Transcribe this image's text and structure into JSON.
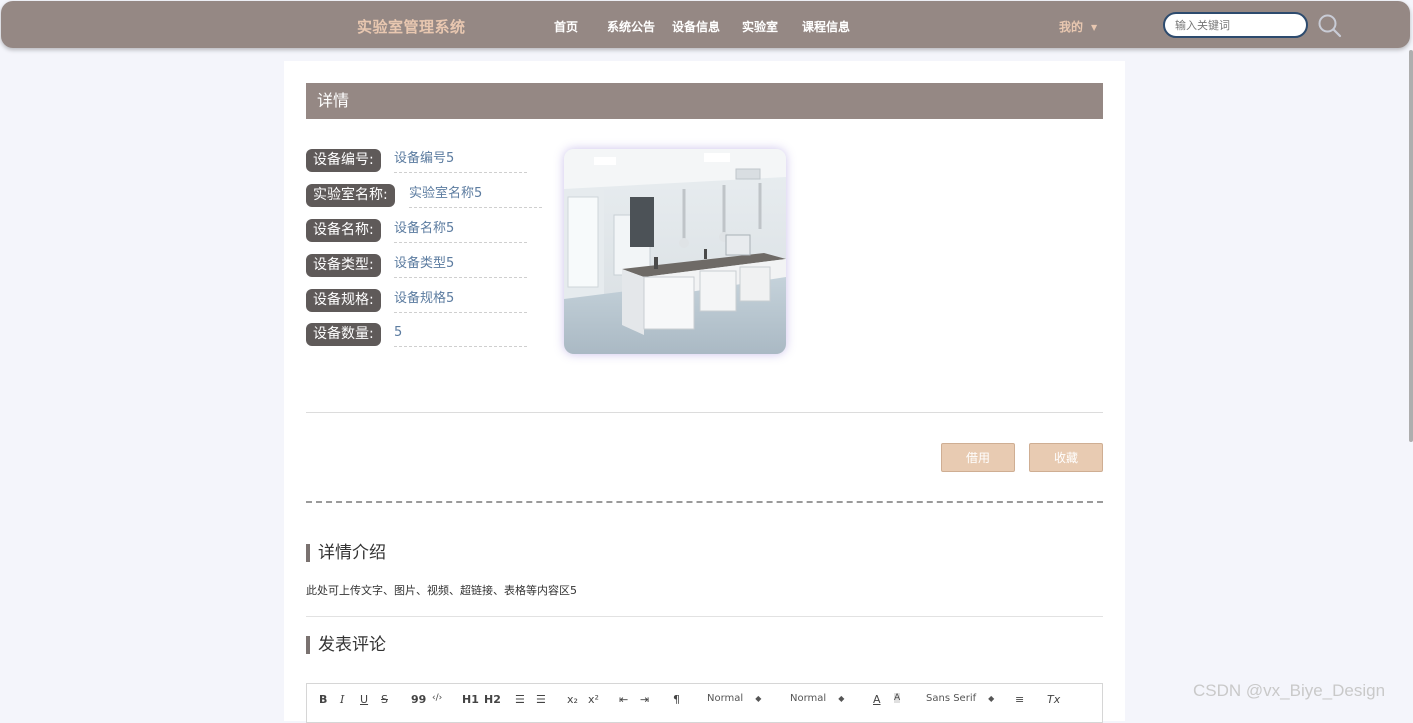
{
  "brand": "实验室管理系统",
  "nav": {
    "items": [
      "首页",
      "系统公告",
      "设备信息",
      "实验室",
      "课程信息"
    ],
    "user_menu": "我的",
    "search_placeholder": "输入关键词"
  },
  "detail": {
    "header": "详情",
    "fields": [
      {
        "label": "设备编号:",
        "value": "设备编号5"
      },
      {
        "label": "实验室名称:",
        "value": "实验室名称5"
      },
      {
        "label": "设备名称:",
        "value": "设备名称5"
      },
      {
        "label": "设备类型:",
        "value": "设备类型5"
      },
      {
        "label": "设备规格:",
        "value": "设备规格5"
      },
      {
        "label": "设备数量:",
        "value": "5"
      }
    ],
    "buttons": {
      "borrow": "借用",
      "favorite": "收藏"
    }
  },
  "intro": {
    "title": "详情介绍",
    "text": "此处可上传文字、图片、视频、超链接、表格等内容区5"
  },
  "comment": {
    "title": "发表评论",
    "toolbar": {
      "bold": "B",
      "italic": "I",
      "underline": "U",
      "strike": "S",
      "quote": "99",
      "code": "‹/›",
      "h1": "H1",
      "h2": "H2",
      "ordered_list": "☰",
      "bullet_list": "☰",
      "subscript": "x₂",
      "superscript": "x²",
      "outdent": "⇤",
      "indent": "⇥",
      "direction": "¶",
      "size_select": "Normal",
      "header_select": "Normal",
      "font_select": "Sans Serif",
      "color": "A",
      "background": "A",
      "align": "≡",
      "clean": "Tx"
    }
  },
  "watermark": "CSDN @vx_Biye_Design",
  "colors": {
    "nav_bg": "#958884",
    "accent": "#e8c7b0",
    "label_bg": "#5f5a59",
    "value_text": "#5c7ca0",
    "button_bg": "#e8cbb2"
  }
}
